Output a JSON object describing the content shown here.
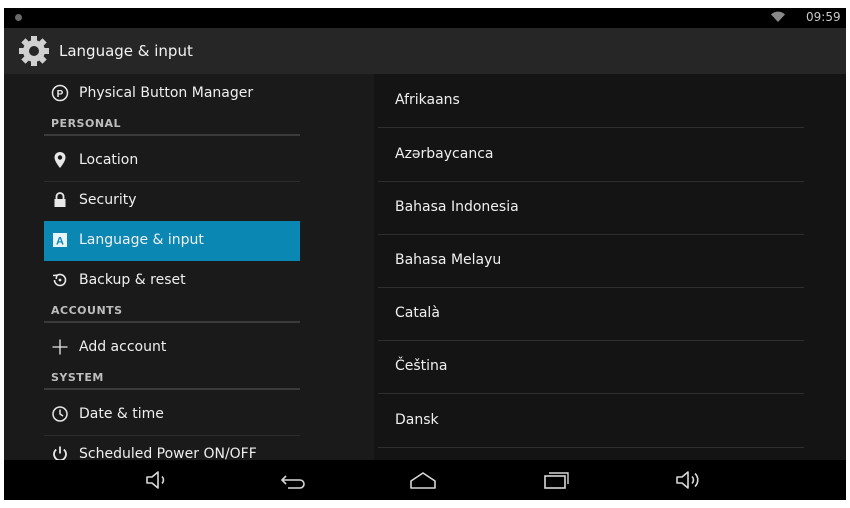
{
  "status_bar": {
    "time": "09:59",
    "icons": [
      "notification-dot-icon",
      "wifi-icon"
    ]
  },
  "action_bar": {
    "title": "Language & input",
    "icon": "settings-gear-icon"
  },
  "settings_list": {
    "items": [
      {
        "label": "Physical Button Manager",
        "icon": "p-circle-icon"
      },
      {
        "header": "PERSONAL"
      },
      {
        "label": "Location",
        "icon": "location-pin-icon"
      },
      {
        "label": "Security",
        "icon": "lock-icon"
      },
      {
        "label": "Language & input",
        "icon": "language-a-icon",
        "selected": true
      },
      {
        "label": "Backup & reset",
        "icon": "backup-restore-icon"
      },
      {
        "header": "ACCOUNTS"
      },
      {
        "label": "Add account",
        "icon": "plus-icon"
      },
      {
        "header": "SYSTEM"
      },
      {
        "label": "Date & time",
        "icon": "clock-icon"
      },
      {
        "label": "Scheduled Power ON/OFF",
        "icon": "power-icon"
      }
    ]
  },
  "languages": [
    "Afrikaans",
    "Azərbaycanca",
    "Bahasa Indonesia",
    "Bahasa Melayu",
    "Català",
    "Čeština",
    "Dansk"
  ],
  "nav_bar": {
    "buttons": [
      "volume-down-icon",
      "back-icon",
      "home-icon",
      "recent-apps-icon",
      "volume-up-icon"
    ]
  },
  "colors": {
    "accent": "#0b87b4",
    "background": "#1a1a1a",
    "text": "#efefef"
  }
}
